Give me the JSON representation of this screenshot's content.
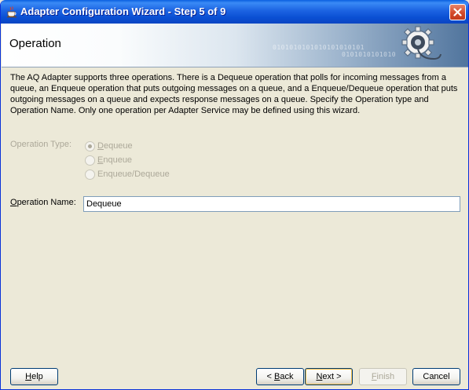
{
  "window": {
    "title": "Adapter Configuration Wizard - Step 5 of 9",
    "icons": {
      "app": "java-cup-icon",
      "close": "close-icon"
    }
  },
  "banner": {
    "heading": "Operation",
    "decoration_text": "0101010101010101010101",
    "decoration_text2": "0101010101010",
    "icon": "gear-plug-icon"
  },
  "description": "The AQ Adapter supports three operations.  There is a Dequeue operation that polls for incoming messages from a queue, an Enqueue operation that puts outgoing messages on a queue, and a Enqueue/Dequeue operation that puts outgoing messages on a queue and expects response messages on a queue.  Specify the Operation type and Operation Name. Only one operation per Adapter Service may be defined using this wizard.",
  "operation_type": {
    "label": "Operation Type:",
    "options": [
      {
        "mnemonic": "D",
        "rest": "equeue",
        "selected": true
      },
      {
        "mnemonic": "E",
        "rest": "nqueue",
        "selected": false
      },
      {
        "mnemonic": "",
        "rest": "Enqueue/Dequeue",
        "selected": false
      }
    ]
  },
  "operation_name": {
    "label_mnemonic": "O",
    "label_rest": "peration Name:",
    "value": "Dequeue"
  },
  "buttons": {
    "help": {
      "mnemonic": "H",
      "rest": "elp"
    },
    "back": {
      "prefix": "< ",
      "mnemonic": "B",
      "rest": "ack"
    },
    "next": {
      "mnemonic": "N",
      "rest": "ext >"
    },
    "finish": {
      "mnemonic": "F",
      "rest": "inish"
    },
    "cancel": "Cancel"
  }
}
